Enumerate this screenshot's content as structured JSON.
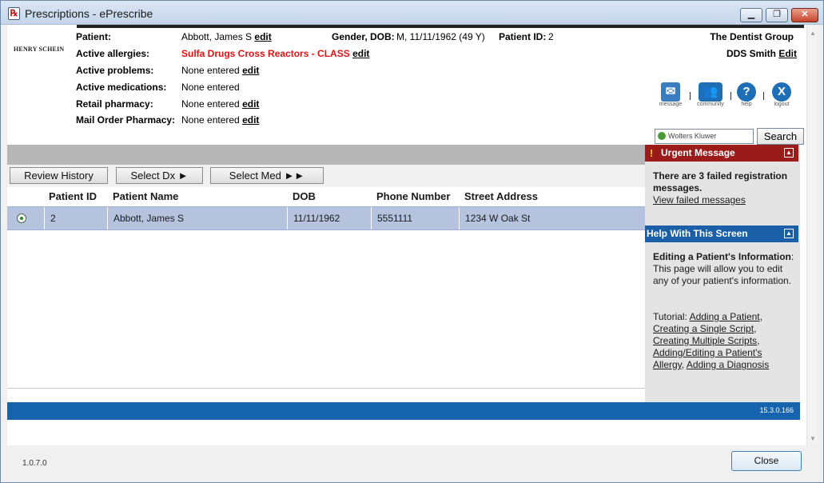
{
  "window": {
    "title": "Prescriptions - ePrescribe",
    "icon": "prescription-icon",
    "controls": [
      "minimize-icon",
      "restore-icon",
      "close-icon"
    ]
  },
  "brand": {
    "logo_text": "HENRY SCHEIN"
  },
  "patient": {
    "patient_label": "Patient:",
    "patient_name": "Abbott, James S",
    "allergies_label": "Active allergies:",
    "allergies_value": "Sulfa Drugs Cross Reactors - CLASS",
    "problems_label": "Active problems:",
    "problems_value": "None entered",
    "medications_label": "Active medications:",
    "medications_value": "None entered",
    "retail_label": "Retail pharmacy:",
    "retail_value": "None entered",
    "mail_label": "Mail Order Pharmacy:",
    "mail_value": "None entered",
    "edit_link": "edit",
    "gender_dob_label": "Gender, DOB:",
    "gender_dob_value": "M, 11/11/1962 (49 Y)",
    "patient_id_label": "Patient ID:",
    "patient_id_value": "2"
  },
  "practice": {
    "group_name": "The Dentist Group",
    "provider": "DDS Smith",
    "edit_label": "Edit"
  },
  "toolbar_icons": [
    {
      "icon": "message-icon",
      "label": "message"
    },
    {
      "icon": "community-icon",
      "label": "community"
    },
    {
      "icon": "help-icon",
      "label": "help"
    },
    {
      "icon": "logout-icon",
      "label": "logout"
    }
  ],
  "search": {
    "box_text": "Wolters Kluwer",
    "button": "Search"
  },
  "actions": {
    "review_history": "Review History",
    "select_dx": "Select Dx ►",
    "select_med": "Select Med ►►"
  },
  "table": {
    "columns": [
      "Patient ID",
      "Patient Name",
      "DOB",
      "Phone Number",
      "Street Address"
    ],
    "rows": [
      {
        "selected": true,
        "patient_id": "2",
        "name": "Abbott, James S",
        "dob": "11/11/1962",
        "phone": "5551111",
        "address": "1234 W Oak St"
      }
    ]
  },
  "urgent": {
    "title": "Urgent Message",
    "message": "There are 3 failed registration messages.",
    "link": "View failed messages"
  },
  "help": {
    "title": "Help With This Screen",
    "heading": "Editing a Patient's Information",
    "body": ": This page will allow you to edit any of your patient's information.",
    "tutorial_label": "Tutorial:",
    "links": [
      "Adding a Patient",
      "Creating a Single Script",
      "Creating Multiple Scripts",
      "Adding/Editing a Patient's Allergy",
      "Adding a Diagnosis"
    ]
  },
  "footer": {
    "build": "15.3.0.166",
    "version": "1.0.7.0",
    "close_button": "Close"
  },
  "colors": {
    "allergy": "#e31010",
    "urgent_header": "#9b1b1b",
    "help_header": "#1b5fa8",
    "status_bar": "#1664ad",
    "selected_row": "#b5c3df"
  }
}
